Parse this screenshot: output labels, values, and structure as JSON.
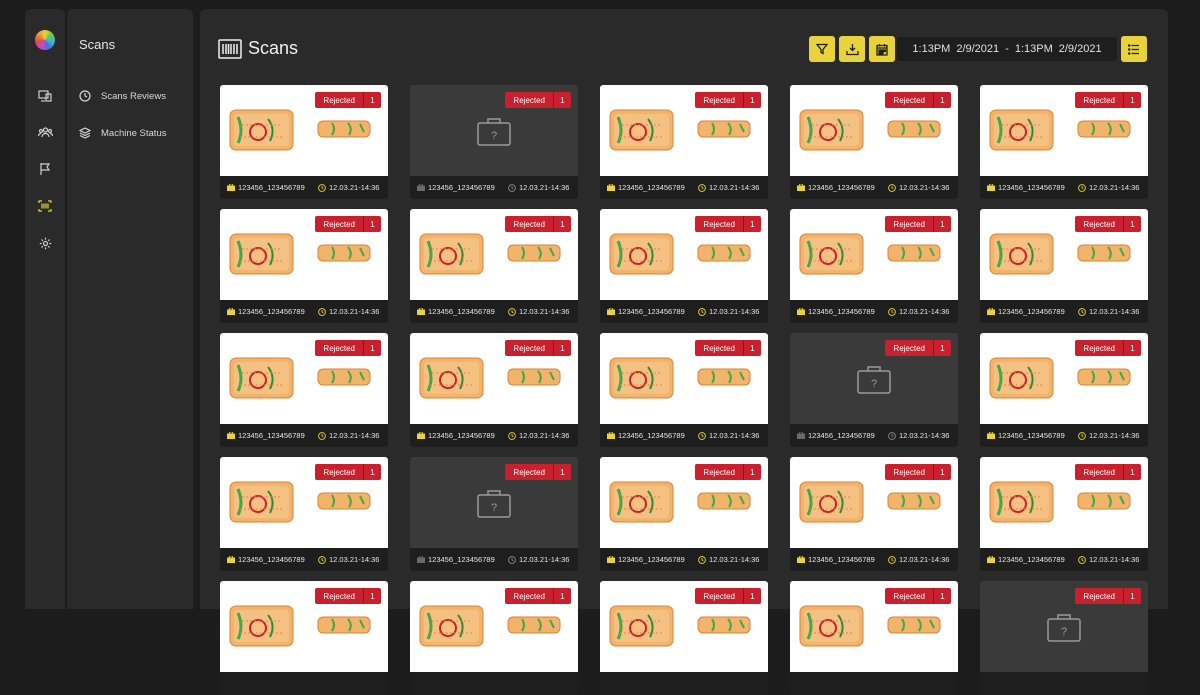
{
  "app": {
    "accent": "#e8d33c",
    "reject_color": "#c8202c"
  },
  "rail": {
    "items": [
      {
        "icon": "monitor-icon"
      },
      {
        "icon": "users-icon"
      },
      {
        "icon": "flag-icon"
      },
      {
        "icon": "barcode-scan-icon",
        "active": true
      },
      {
        "icon": "gear-icon"
      }
    ]
  },
  "sidebar": {
    "title": "Scans",
    "items": [
      {
        "label": "Scans Reviews",
        "icon": "clock-icon"
      },
      {
        "label": "Machine Status",
        "icon": "layers-icon"
      }
    ]
  },
  "header": {
    "title": "Scans",
    "toolbar": {
      "filter_icon": "filter-icon",
      "download_icon": "download-icon",
      "calendar_icon": "calendar-icon",
      "list_icon": "list-icon"
    },
    "date_range": {
      "from_time": "1:13PM",
      "from_date": "2/9/2021",
      "separator": "-",
      "to_time": "1:13PM",
      "to_date": "2/9/2021"
    }
  },
  "scans": [
    {
      "status": "Rejected",
      "count": "1",
      "id": "123456_123456789",
      "time": "12.03.21-14:36",
      "image": "xray"
    },
    {
      "status": "Rejected",
      "count": "1",
      "id": "123456_123456789",
      "time": "12.03.21-14:36",
      "image": "unknown"
    },
    {
      "status": "Rejected",
      "count": "1",
      "id": "123456_123456789",
      "time": "12.03.21-14:36",
      "image": "xray"
    },
    {
      "status": "Rejected",
      "count": "1",
      "id": "123456_123456789",
      "time": "12.03.21-14:36",
      "image": "xray"
    },
    {
      "status": "Rejected",
      "count": "1",
      "id": "123456_123456789",
      "time": "12.03.21-14:36",
      "image": "xray"
    },
    {
      "status": "Rejected",
      "count": "1",
      "id": "123456_123456789",
      "time": "12.03.21-14:36",
      "image": "xray"
    },
    {
      "status": "Rejected",
      "count": "1",
      "id": "123456_123456789",
      "time": "12.03.21-14:36",
      "image": "xray"
    },
    {
      "status": "Rejected",
      "count": "1",
      "id": "123456_123456789",
      "time": "12.03.21-14:36",
      "image": "xray"
    },
    {
      "status": "Rejected",
      "count": "1",
      "id": "123456_123456789",
      "time": "12.03.21-14:36",
      "image": "xray"
    },
    {
      "status": "Rejected",
      "count": "1",
      "id": "123456_123456789",
      "time": "12.03.21-14:36",
      "image": "xray"
    },
    {
      "status": "Rejected",
      "count": "1",
      "id": "123456_123456789",
      "time": "12.03.21-14:36",
      "image": "xray"
    },
    {
      "status": "Rejected",
      "count": "1",
      "id": "123456_123456789",
      "time": "12.03.21-14:36",
      "image": "xray"
    },
    {
      "status": "Rejected",
      "count": "1",
      "id": "123456_123456789",
      "time": "12.03.21-14:36",
      "image": "xray"
    },
    {
      "status": "Rejected",
      "count": "1",
      "id": "123456_123456789",
      "time": "12.03.21-14:36",
      "image": "unknown"
    },
    {
      "status": "Rejected",
      "count": "1",
      "id": "123456_123456789",
      "time": "12.03.21-14:36",
      "image": "xray"
    },
    {
      "status": "Rejected",
      "count": "1",
      "id": "123456_123456789",
      "time": "12.03.21-14:36",
      "image": "xray"
    },
    {
      "status": "Rejected",
      "count": "1",
      "id": "123456_123456789",
      "time": "12.03.21-14:36",
      "image": "unknown"
    },
    {
      "status": "Rejected",
      "count": "1",
      "id": "123456_123456789",
      "time": "12.03.21-14:36",
      "image": "xray"
    },
    {
      "status": "Rejected",
      "count": "1",
      "id": "123456_123456789",
      "time": "12.03.21-14:36",
      "image": "xray"
    },
    {
      "status": "Rejected",
      "count": "1",
      "id": "123456_123456789",
      "time": "12.03.21-14:36",
      "image": "xray"
    },
    {
      "status": "Rejected",
      "count": "1",
      "image": "xray"
    },
    {
      "status": "Rejected",
      "count": "1",
      "image": "xray"
    },
    {
      "status": "Rejected",
      "count": "1",
      "image": "xray"
    },
    {
      "status": "Rejected",
      "count": "1",
      "image": "xray"
    },
    {
      "status": "Rejected",
      "count": "1",
      "image": "unknown"
    }
  ]
}
